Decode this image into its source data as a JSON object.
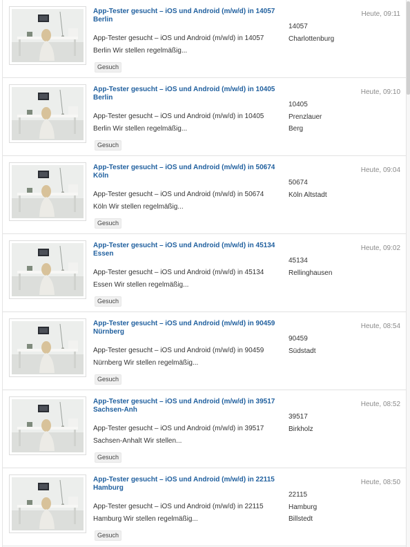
{
  "listings": [
    {
      "title": "App-Tester gesucht – iOS und Android (m/w/d) in 14057 Berlin",
      "desc_line1": "App-Tester gesucht – iOS und Android (m/w/d) in 14057",
      "desc_line2": "Berlin Wir stellen regelmäßig...",
      "tag": "Gesuch",
      "postal": "14057",
      "district": "Charlottenburg",
      "district2": "",
      "time": "Heute, 09:11"
    },
    {
      "title": "App-Tester gesucht – iOS und Android (m/w/d) in 10405 Berlin",
      "desc_line1": "App-Tester gesucht – iOS und Android (m/w/d) in 10405",
      "desc_line2": "Berlin Wir stellen regelmäßig...",
      "tag": "Gesuch",
      "postal": "10405",
      "district": "Prenzlauer",
      "district2": "Berg",
      "time": "Heute, 09:10"
    },
    {
      "title": "App-Tester gesucht – iOS und Android (m/w/d) in 50674 Köln",
      "desc_line1": "App-Tester gesucht – iOS und Android (m/w/d) in 50674",
      "desc_line2": "Köln Wir stellen regelmäßig...",
      "tag": "Gesuch",
      "postal": "50674",
      "district": "Köln Altstadt",
      "district2": "",
      "time": "Heute, 09:04"
    },
    {
      "title": "App-Tester gesucht – iOS und Android (m/w/d) in 45134 Essen",
      "desc_line1": "App-Tester gesucht – iOS und Android (m/w/d) in 45134",
      "desc_line2": "Essen Wir stellen regelmäßig...",
      "tag": "Gesuch",
      "postal": "45134",
      "district": "Rellinghausen",
      "district2": "",
      "time": "Heute, 09:02"
    },
    {
      "title": "App-Tester gesucht – iOS und Android (m/w/d) in 90459 Nürnberg",
      "desc_line1": "App-Tester gesucht – iOS und Android (m/w/d) in 90459",
      "desc_line2": "Nürnberg Wir stellen regelmäßig...",
      "tag": "Gesuch",
      "postal": "90459",
      "district": "Südstadt",
      "district2": "",
      "time": "Heute, 08:54"
    },
    {
      "title": "App-Tester gesucht – iOS und Android (m/w/d) in 39517 Sachsen-Anh",
      "desc_line1": "App-Tester gesucht – iOS und Android (m/w/d) in 39517",
      "desc_line2": "Sachsen-Anhalt Wir stellen...",
      "tag": "Gesuch",
      "postal": "39517",
      "district": "Birkholz",
      "district2": "",
      "time": "Heute, 08:52"
    },
    {
      "title": "App-Tester gesucht – iOS und Android (m/w/d) in 22115 Hamburg",
      "desc_line1": "App-Tester gesucht – iOS und Android (m/w/d) in 22115",
      "desc_line2": "Hamburg Wir stellen regelmäßig...",
      "tag": "Gesuch",
      "postal": "22115",
      "district": "Hamburg",
      "district2": "Billstedt",
      "time": "Heute, 08:50"
    }
  ],
  "colors": {
    "title_link": "#1f5f9e",
    "timestamp": "#8a8a8a",
    "text": "#333333"
  }
}
